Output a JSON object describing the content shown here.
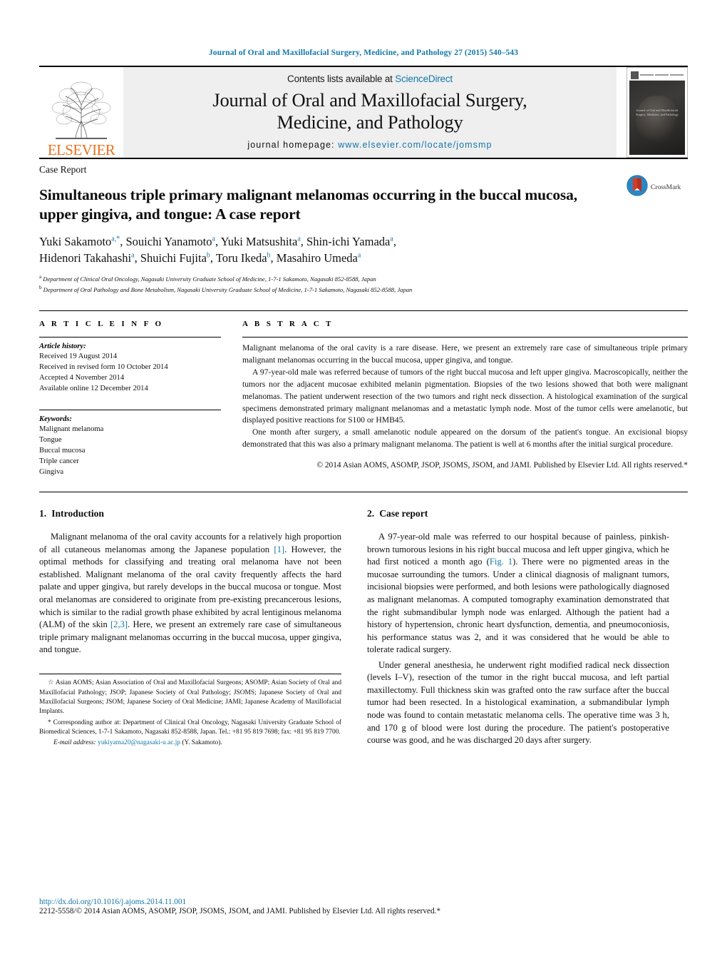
{
  "running_head": "Journal of Oral and Maxillofacial Surgery, Medicine, and Pathology 27 (2015) 540–543",
  "masthead": {
    "publisher_name": "ELSEVIER",
    "contents_prefix": "Contents lists available at ",
    "contents_link": "ScienceDirect",
    "journal_title_line1": "Journal of Oral and Maxillofacial Surgery,",
    "journal_title_line2": "Medicine, and Pathology",
    "homepage_label": "journal homepage:",
    "homepage_url": "www.elsevier.com/locate/jomsmp",
    "cover_caption_line1": "Journal of Oral and Maxillofacial",
    "cover_caption_line2": "Surgery, Medicine, and Pathology"
  },
  "article": {
    "type_label": "Case Report",
    "title": "Simultaneous triple primary malignant melanomas occurring in the buccal mucosa, upper gingiva, and tongue: A case report",
    "crossmark_label": "CrossMark",
    "authors_line1": "Yuki Sakamoto",
    "authors_html_line1": "Yuki Sakamoto<sup>a,</sup><sup>*</sup>, Souichi Yanamoto<sup>a</sup>, Yuki Matsushita<sup>a</sup>, Shin-ichi Yamada<sup>a</sup>,",
    "authors_html_line2": "Hidenori Takahashi<sup>a</sup>, Shuichi Fujita<sup>b</sup>, Toru Ikeda<sup>b</sup>, Masahiro Umeda<sup>a</sup>",
    "affiliation_a": "Department of Clinical Oral Oncology, Nagasaki University Graduate School of Medicine, 1-7-1 Sakamoto, Nagasaki 852-8588, Japan",
    "affiliation_b": "Department of Oral Pathology and Bone Metabolism, Nagasaki University Graduate School of Medicine, 1-7-1 Sakamoto, Nagasaki 852-8588, Japan"
  },
  "article_info": {
    "heading": "A R T I C L E   I N F O",
    "history_title": "Article history:",
    "history": [
      "Received 19 August 2014",
      "Received in revised form 10 October 2014",
      "Accepted 4 November 2014",
      "Available online 12 December 2014"
    ],
    "keywords_title": "Keywords:",
    "keywords": [
      "Malignant melanoma",
      "Tongue",
      "Buccal mucosa",
      "Triple cancer",
      "Gingiva"
    ]
  },
  "abstract": {
    "heading": "A B S T R A C T",
    "paragraphs": [
      "Malignant melanoma of the oral cavity is a rare disease. Here, we present an extremely rare case of simultaneous triple primary malignant melanomas occurring in the buccal mucosa, upper gingiva, and tongue.",
      "A 97-year-old male was referred because of tumors of the right buccal mucosa and left upper gingiva. Macroscopically, neither the tumors nor the adjacent mucosae exhibited melanin pigmentation. Biopsies of the two lesions showed that both were malignant melanomas. The patient underwent resection of the two tumors and right neck dissection. A histological examination of the surgical specimens demonstrated primary malignant melanomas and a metastatic lymph node. Most of the tumor cells were amelanotic, but displayed positive reactions for S100 or HMB45.",
      "One month after surgery, a small amelanotic nodule appeared on the dorsum of the patient's tongue. An excisional biopsy demonstrated that this was also a primary malignant melanoma. The patient is well at 6 months after the initial surgical procedure."
    ],
    "copyright": "© 2014 Asian AOMS, ASOMP, JSOP, JSOMS, JSOM, and JAMI. Published by Elsevier Ltd. All rights reserved.*"
  },
  "sections": {
    "introduction": {
      "number": "1.",
      "title": "Introduction",
      "paragraph_part1": "Malignant melanoma of the oral cavity accounts for a relatively high proportion of all cutaneous melanomas among the Japanese population ",
      "ref1": "[1]",
      "paragraph_part2": ". However, the optimal methods for classifying and treating oral melanoma have not been established. Malignant melanoma of the oral cavity frequently affects the hard palate and upper gingiva, but rarely develops in the buccal mucosa or tongue. Most oral melanomas are considered to originate from pre-existing precancerous lesions, which is similar to the radial growth phase exhibited by acral lentiginous melanoma (ALM) of the skin ",
      "ref2": "[2,3]",
      "paragraph_part3": ". Here, we present an extremely rare case of simultaneous triple primary malignant melanomas occurring in the buccal mucosa, upper gingiva, and tongue."
    },
    "case_report": {
      "number": "2.",
      "title": "Case report",
      "p1_part1": "A 97-year-old male was referred to our hospital because of painless, pinkish-brown tumorous lesions in his right buccal mucosa and left upper gingiva, which he had first noticed a month ago (",
      "p1_figref": "Fig. 1",
      "p1_part2": "). There were no pigmented areas in the mucosae surrounding the tumors. Under a clinical diagnosis of malignant tumors, incisional biopsies were performed, and both lesions were pathologically diagnosed as malignant melanomas. A computed tomography examination demonstrated that the right submandibular lymph node was enlarged. Although the patient had a history of hypertension, chronic heart dysfunction, dementia, and pneumoconiosis, his performance status was 2, and it was considered that he would be able to tolerate radical surgery.",
      "p2": "Under general anesthesia, he underwent right modified radical neck dissection (levels I–V), resection of the tumor in the right buccal mucosa, and left partial maxillectomy. Full thickness skin was grafted onto the raw surface after the buccal tumor had been resected. In a histological examination, a submandibular lymph node was found to contain metastatic melanoma cells. The operative time was 3 h, and 170 g of blood were lost during the procedure. The patient's postoperative course was good, and he was discharged 20 days after surgery."
    }
  },
  "footnotes": {
    "abbreviations": "Asian AOMS; Asian Association of Oral and Maxillofacial Surgeons; ASOMP; Asian Society of Oral and Maxillofacial Pathology; JSOP; Japanese Society of Oral Pathology; JSOMS; Japanese Society of Oral and Maxillofacial Surgeons; JSOM; Japanese Society of Oral Medicine; JAMI; Japanese Academy of Maxillofacial Implants.",
    "corresponding": "Corresponding author at: Department of Clinical Oral Oncology, Nagasaki University Graduate School of Biomedical Sciences, 1-7-1 Sakamoto, Nagasaki 852-8588, Japan. Tel.: +81 95 819 7698; fax: +81 95 819 7700.",
    "email_label": "E-mail address:",
    "email": "yukiyama20@nagasaki-u.ac.jp",
    "email_suffix": "(Y. Sakamoto)."
  },
  "bottom": {
    "doi_url": "http://dx.doi.org/10.1016/j.ajoms.2014.11.001",
    "issn_line": "2212-5558/© 2014 Asian AOMS, ASOMP, JSOP, JSOMS, JSOM, and JAMI. Published by Elsevier Ltd. All rights reserved.*"
  },
  "colors": {
    "link": "#1277a8",
    "elsevier_orange": "#e9711c",
    "masthead_bg": "#efeff0"
  }
}
